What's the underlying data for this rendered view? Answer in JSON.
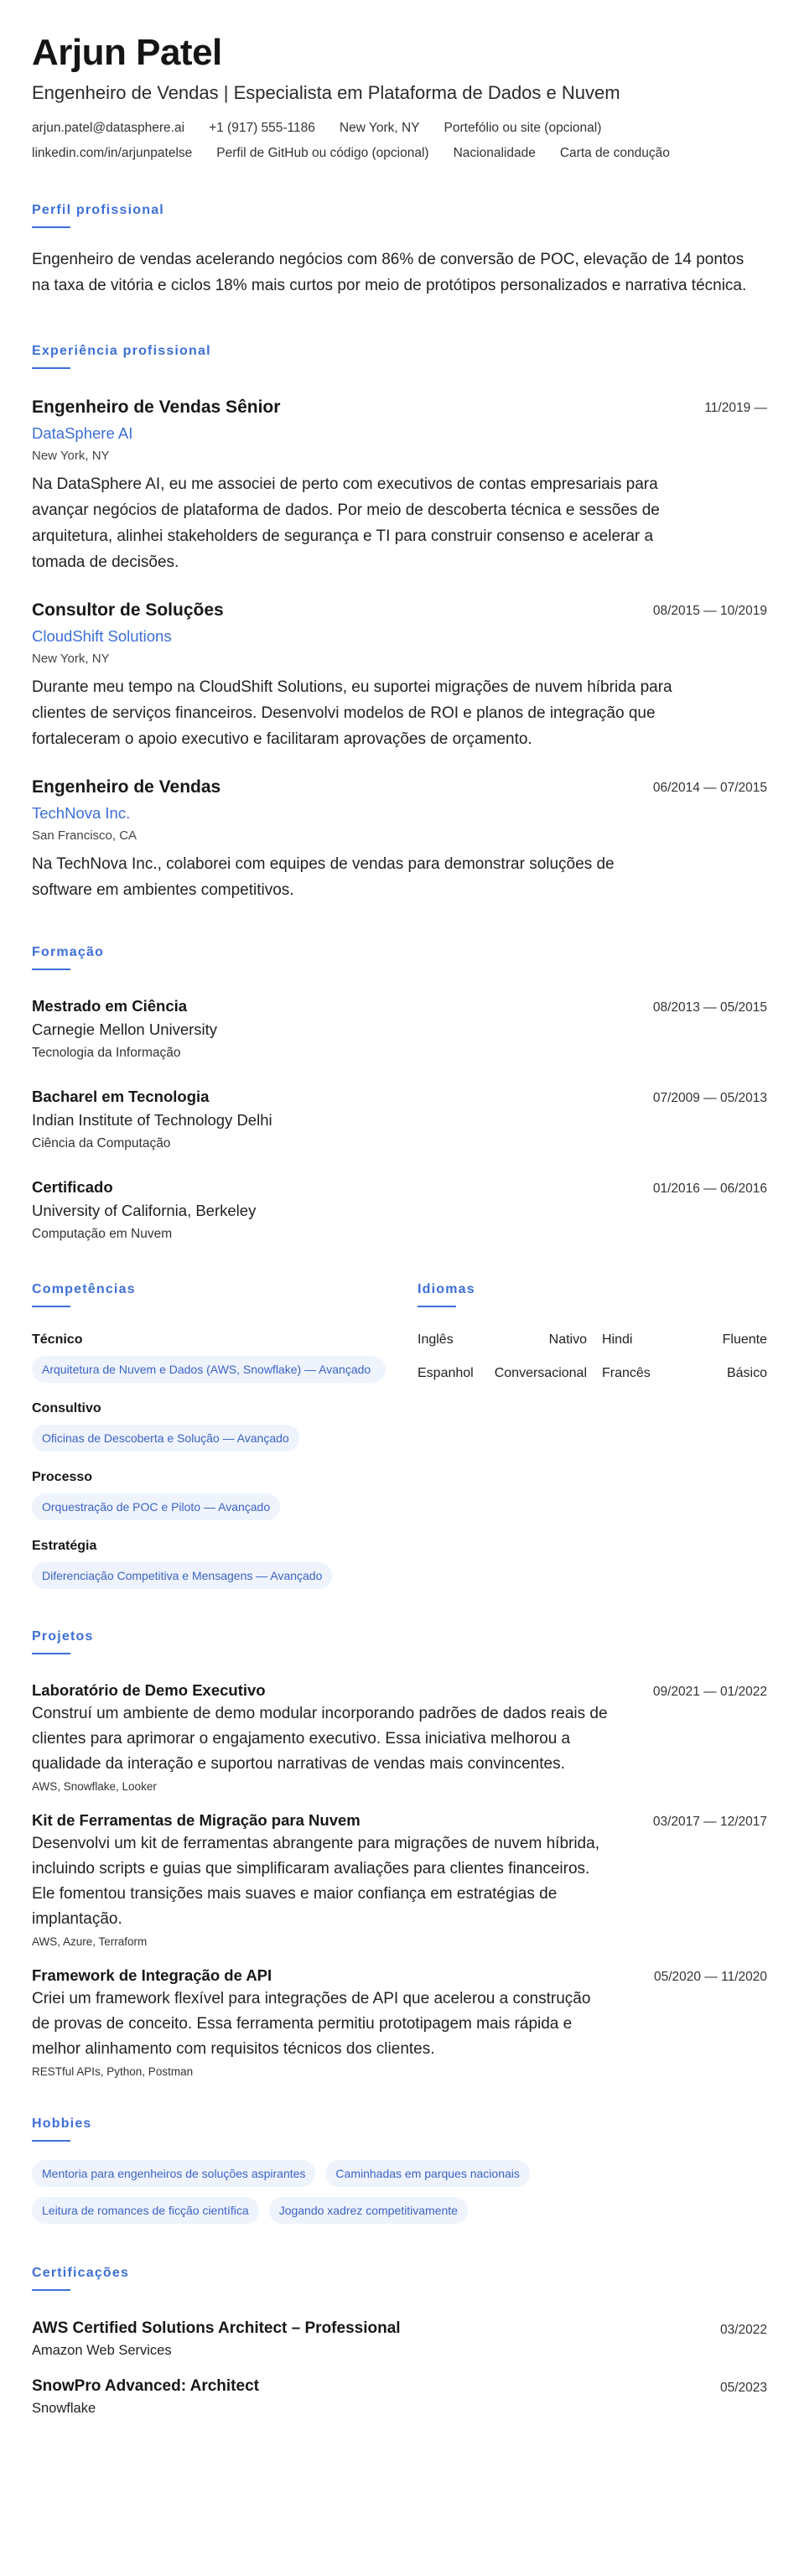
{
  "header": {
    "name": "Arjun Patel",
    "headline": "Engenheiro de Vendas | Especialista em Plataforma de Dados e Nuvem",
    "contacts": [
      "arjun.patel@datasphere.ai",
      "+1 (917) 555-1186",
      "New York, NY",
      "Portefólio ou site (opcional)",
      "linkedin.com/in/arjunpatelse",
      "Perfil de GitHub ou código (opcional)",
      "Nacionalidade",
      "Carta de condução"
    ]
  },
  "summary": {
    "title": "Perfil profissional",
    "text": "Engenheiro de vendas acelerando negócios com 86% de conversão de POC, elevação de 14 pontos na taxa de vitória e ciclos 18% mais curtos por meio de protótipos personalizados e narrativa técnica."
  },
  "experience": {
    "title": "Experiência profissional",
    "jobs": [
      {
        "title": "Engenheiro de Vendas Sênior",
        "company": "DataSphere AI",
        "location": "New York, NY",
        "dates": "11/2019 —",
        "desc": "Na DataSphere AI, eu me associei de perto com executivos de contas empresariais para avançar negócios de plataforma de dados. Por meio de descoberta técnica e sessões de arquitetura, alinhei stakeholders de segurança e TI para construir consenso e acelerar a tomada de decisões."
      },
      {
        "title": "Consultor de Soluções",
        "company": "CloudShift Solutions",
        "location": "New York, NY",
        "dates": "08/2015 — 10/2019",
        "desc": "Durante meu tempo na CloudShift Solutions, eu suportei migrações de nuvem híbrida para clientes de serviços financeiros. Desenvolvi modelos de ROI e planos de integração que fortaleceram o apoio executivo e facilitaram aprovações de orçamento."
      },
      {
        "title": "Engenheiro de Vendas",
        "company": "TechNova Inc.",
        "location": "San Francisco, CA",
        "dates": "06/2014 — 07/2015",
        "desc": "Na TechNova Inc., colaborei com equipes de vendas para demonstrar soluções de software em ambientes competitivos."
      }
    ]
  },
  "education": {
    "title": "Formação",
    "items": [
      {
        "degree": "Mestrado em Ciência",
        "school": "Carnegie Mellon University",
        "field": "Tecnologia da Informação",
        "dates": "08/2013 — 05/2015"
      },
      {
        "degree": "Bacharel em Tecnologia",
        "school": "Indian Institute of Technology Delhi",
        "field": "Ciência da Computação",
        "dates": "07/2009 — 05/2013"
      },
      {
        "degree": "Certificado",
        "school": "University of California, Berkeley",
        "field": "Computação em Nuvem",
        "dates": "01/2016 — 06/2016"
      }
    ]
  },
  "skills": {
    "title": "Competências",
    "groups": [
      {
        "name": "Técnico",
        "chip": "Arquitetura de Nuvem e Dados (AWS, Snowflake) — Avançado"
      },
      {
        "name": "Consultivo",
        "chip": "Oficinas de Descoberta e Solução — Avançado"
      },
      {
        "name": "Processo",
        "chip": "Orquestração de POC e Piloto — Avançado"
      },
      {
        "name": "Estratégia",
        "chip": "Diferenciação Competitiva e Mensagens — Avançado"
      }
    ]
  },
  "languages": {
    "title": "Idiomas",
    "items": [
      {
        "name": "Inglês",
        "level": "Nativo"
      },
      {
        "name": "Hindi",
        "level": "Fluente"
      },
      {
        "name": "Espanhol",
        "level": "Conversacional"
      },
      {
        "name": "Francês",
        "level": "Básico"
      }
    ]
  },
  "projects": {
    "title": "Projetos",
    "items": [
      {
        "title": "Laboratório de Demo Executivo",
        "dates": "09/2021 — 01/2022",
        "desc": "Construí um ambiente de demo modular incorporando padrões de dados reais de clientes para aprimorar o engajamento executivo. Essa iniciativa melhorou a qualidade da interação e suportou narrativas de vendas mais convincentes.",
        "tech": "AWS, Snowflake, Looker"
      },
      {
        "title": "Kit de Ferramentas de Migração para Nuvem",
        "dates": "03/2017 — 12/2017",
        "desc": "Desenvolvi um kit de ferramentas abrangente para migrações de nuvem híbrida, incluindo scripts e guias que simplificaram avaliações para clientes financeiros. Ele fomentou transições mais suaves e maior confiança em estratégias de implantação.",
        "tech": "AWS, Azure, Terraform"
      },
      {
        "title": "Framework de Integração de API",
        "dates": "05/2020 — 11/2020",
        "desc": "Criei um framework flexível para integrações de API que acelerou a construção de provas de conceito. Essa ferramenta permitiu prototipagem mais rápida e melhor alinhamento com requisitos técnicos dos clientes.",
        "tech": "RESTful APIs, Python, Postman"
      }
    ]
  },
  "hobbies": {
    "title": "Hobbies",
    "items": [
      "Mentoria para engenheiros de soluções aspirantes",
      "Caminhadas em parques nacionais",
      "Leitura de romances de ficção científica",
      "Jogando xadrez competitivamente"
    ]
  },
  "certifications": {
    "title": "Certificações",
    "items": [
      {
        "name": "AWS Certified Solutions Architect – Professional",
        "issuer": "Amazon Web Services",
        "date": "03/2022"
      },
      {
        "name": "SnowPro Advanced: Architect",
        "issuer": "Snowflake",
        "date": "05/2023"
      }
    ]
  },
  "colors": {
    "accent": "#3d6fd6",
    "chip_bg": "#eef3fc",
    "text": "#1f1f1f"
  }
}
